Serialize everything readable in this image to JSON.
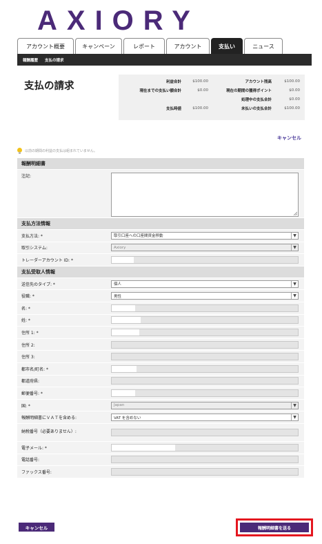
{
  "brand": {
    "logo_text": "AXIORY"
  },
  "tabs": [
    {
      "label": "アカウント概要"
    },
    {
      "label": "キャンペーン"
    },
    {
      "label": "レポート"
    },
    {
      "label": "アカウント"
    },
    {
      "label": "支払い"
    },
    {
      "label": "ニュース"
    }
  ],
  "subnav": {
    "item1": "報酬履歴",
    "item2": "支払の請求"
  },
  "page": {
    "title": "支払の請求",
    "cancel_link": "キャンセル"
  },
  "summary": {
    "row1": {
      "l1": "利益合計",
      "v1": "$100.00",
      "l2": "アカウント残高",
      "v2": "$100.00"
    },
    "row2": {
      "l1": "現在までの支払い額合計",
      "v1": "$0.00",
      "l2": "現在の期間の獲得ポイント",
      "v2": "$0.00"
    },
    "row3": {
      "l1": "",
      "v1": "",
      "l2": "処理中の支払合計",
      "v2": "$0.00"
    },
    "row4": {
      "l1": "支払時値",
      "v1": "$100.00",
      "l2": "未払いの支払合計",
      "v2": "$100.00"
    }
  },
  "notice": "以前の期間の利益の支払は組まれていません。",
  "sections": {
    "statement": "報酬明細書",
    "payment": "支払方法情報",
    "recipient": "支払受取人情報"
  },
  "fields": {
    "note": "注記:",
    "payment_method": "支払方法: *",
    "payment_method_value": "取引口座への口座間資金移動",
    "trading_system": "取引システム:",
    "trading_system_value": "Axiory",
    "trader_account": "トレーダーアカウント ID: *",
    "payee_type": "送信先のタイプ: *",
    "payee_type_value": "個人",
    "title": "役職: *",
    "title_value": "男性",
    "first_name": "名: *",
    "last_name": "姓: *",
    "address1": "住所 1: *",
    "address2": "住所 2:",
    "address3": "住所 3:",
    "city": "都市名/町名: *",
    "state": "都道府県:",
    "zip": "郵便番号: *",
    "country": "国: *",
    "country_value": "Japan",
    "vat_include": "報酬明細書にＶＡＴを含める:",
    "vat_include_value": "VAT を含めない",
    "tax_number": "納税番号（必要ありません）:",
    "email": "電子メール: *",
    "phone": "電話番号:",
    "fax": "ファックス番号:"
  },
  "buttons": {
    "cancel": "キャンセル",
    "send": "報酬明細書を送る"
  },
  "colors": {
    "brand": "#4b2a78",
    "highlight": "#e4161f"
  }
}
